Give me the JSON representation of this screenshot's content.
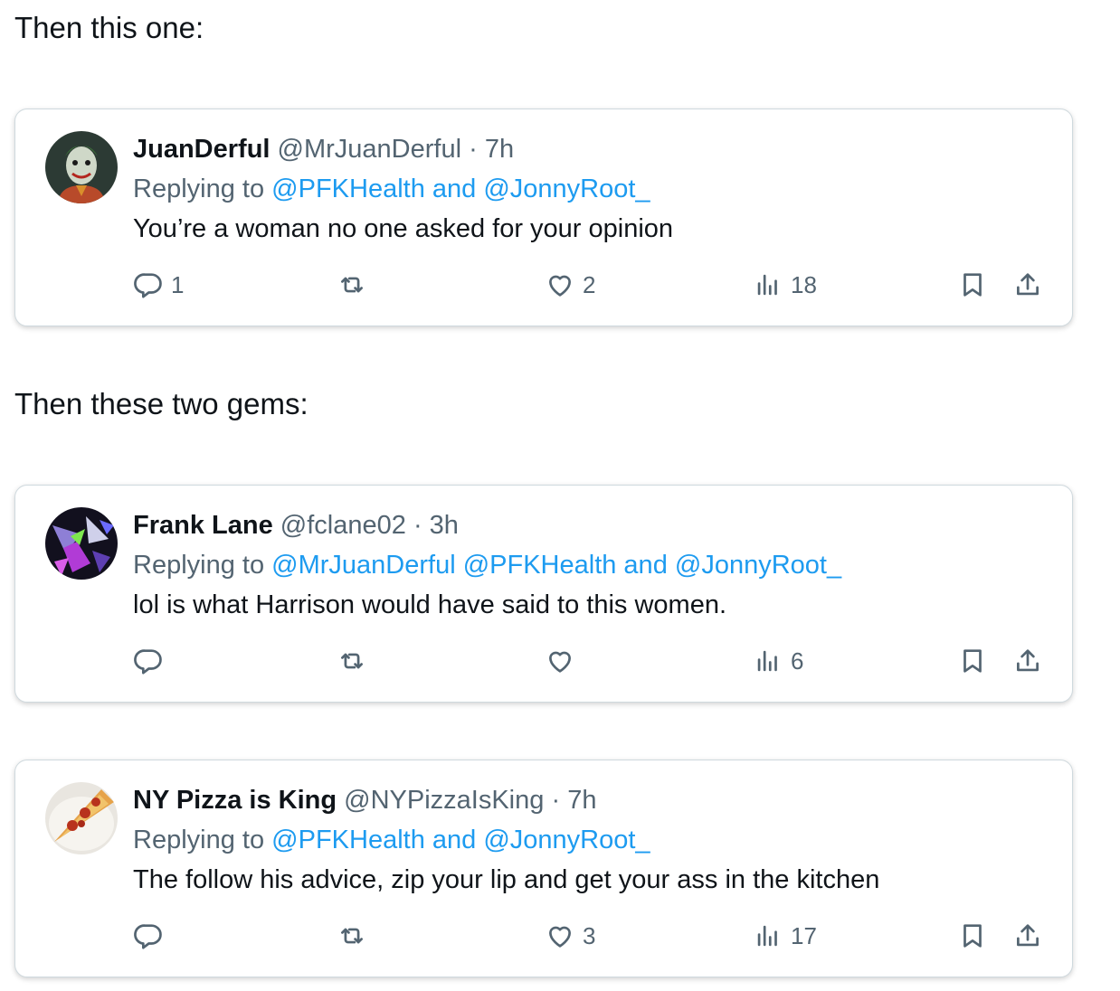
{
  "headings": {
    "first": "Then this one:",
    "second": "Then these two gems:"
  },
  "tweets": [
    {
      "name": "JuanDerful",
      "handle": "@MrJuanDerful",
      "separator": "·",
      "time": "7h",
      "replying_prefix": "Replying to",
      "replying_to": "@PFKHealth and @JonnyRoot_",
      "text": "You’re a woman no one asked for your opinion",
      "counts": {
        "reply": "1",
        "retweet": "",
        "like": "2",
        "views": "18"
      }
    },
    {
      "name": "Frank Lane",
      "handle": "@fclane02",
      "separator": "·",
      "time": "3h",
      "replying_prefix": "Replying to",
      "replying_to": "@MrJuanDerful @PFKHealth and @JonnyRoot_",
      "text": "lol is what Harrison would have said to this women.",
      "counts": {
        "reply": "",
        "retweet": "",
        "like": "",
        "views": "6"
      }
    },
    {
      "name": "NY Pizza is King",
      "handle": "@NYPizzaIsKing",
      "separator": "·",
      "time": "7h",
      "replying_prefix": "Replying to",
      "replying_to": "@PFKHealth and @JonnyRoot_",
      "text": "The follow his advice, zip your lip and get your ass in the kitchen",
      "counts": {
        "reply": "",
        "retweet": "",
        "like": "3",
        "views": "17"
      }
    }
  ],
  "colors": {
    "mention": "#1d9bf0",
    "secondary_text": "#536471",
    "card_border": "#cfd9de"
  },
  "icons": [
    "reply-icon",
    "retweet-icon",
    "like-icon",
    "views-icon",
    "bookmark-icon",
    "share-icon"
  ]
}
